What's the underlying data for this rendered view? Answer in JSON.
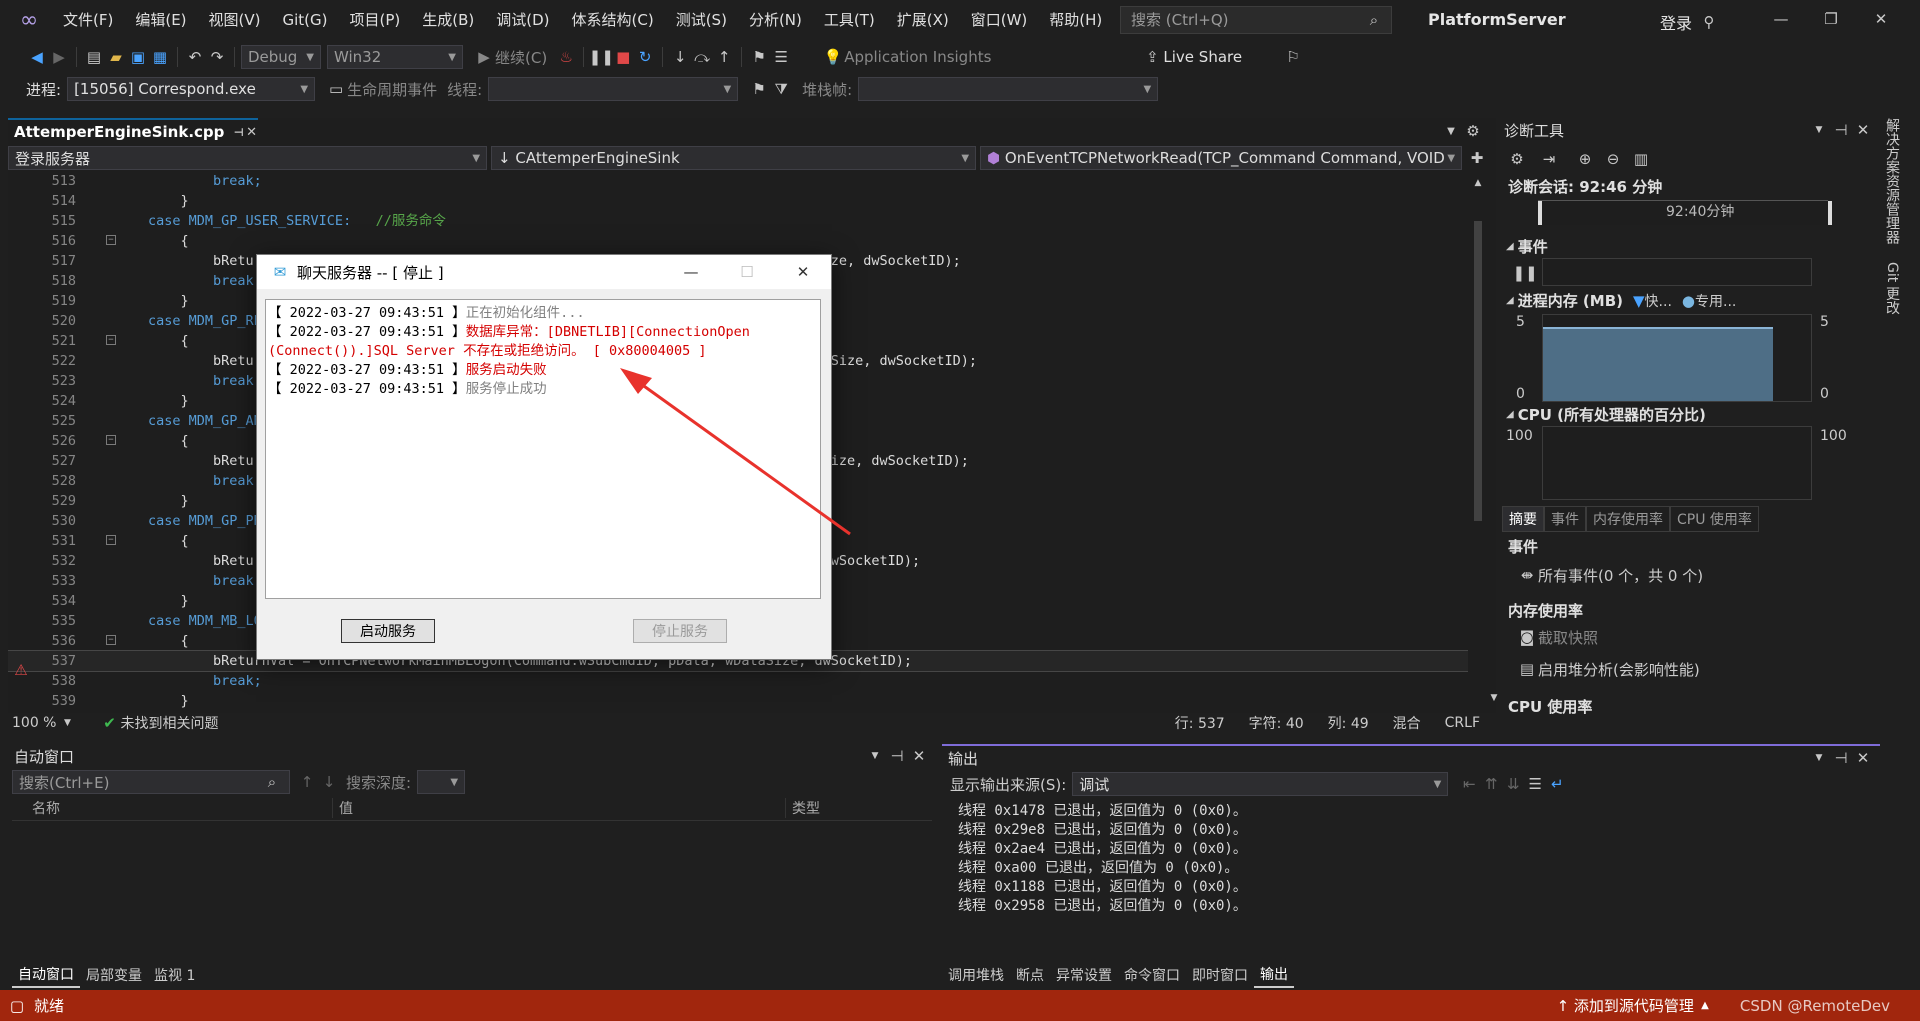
{
  "menu": {
    "items": [
      "文件(F)",
      "编辑(E)",
      "视图(V)",
      "Git(G)",
      "项目(P)",
      "生成(B)",
      "调试(D)",
      "体系结构(C)",
      "测试(S)",
      "分析(N)",
      "工具(T)",
      "扩展(X)",
      "窗口(W)",
      "帮助(H)"
    ],
    "search_placeholder": "搜索 (Ctrl+Q)",
    "app_title": "PlatformServer",
    "login": "登录"
  },
  "toolbar": {
    "config": "Debug",
    "platform": "Win32",
    "continue": "继续(C)",
    "insights": "Application Insights",
    "live_share": "Live Share",
    "process_label": "进程:",
    "process_value": "[15056] Correspond.exe",
    "lifecycle": "生命周期事件",
    "thread_label": "线程:",
    "stack_label": "堆栈帧:"
  },
  "editor": {
    "tab_name": "AttemperEngineSink.cpp",
    "nav_scope": "登录服务器",
    "nav_class": "CAttemperEngineSink",
    "nav_method": "OnEventTCPNetworkRead(TCP_Command Command, VOID *",
    "lines": [
      {
        "n": "513",
        "t": "        break;"
      },
      {
        "n": "514",
        "t": "    }"
      },
      {
        "n": "515",
        "t": "case MDM_GP_USER_SERVICE:   //服务命令"
      },
      {
        "n": "516",
        "t": "    {"
      },
      {
        "n": "517",
        "t": "        bReturnVal = OnTCPNetworkMainPCUserService(Command.wSubCmdID, pData, wDataSize, dwSocketID);"
      },
      {
        "n": "518",
        "t": "        break;"
      },
      {
        "n": "519",
        "t": "    }"
      },
      {
        "n": "520",
        "t": "case MDM_GP_REMOTE_SERVICE:"
      },
      {
        "n": "521",
        "t": "    {"
      },
      {
        "n": "522",
        "t": "        bReturnVal = OnTCPNetworkMainPCRemoteService(Command.wSubCmdID, pData, wDataSize, dwSocketID);"
      },
      {
        "n": "523",
        "t": "        break;"
      },
      {
        "n": "524",
        "t": "    }"
      },
      {
        "n": "525",
        "t": "case MDM_GP_ANDROID_SERVICE:"
      },
      {
        "n": "526",
        "t": "    {"
      },
      {
        "n": "527",
        "t": "        bReturnVal = OnTCPNetworkMainAndroidService(Command.wSubCmdID, pData, wDataSize, dwSocketID);"
      },
      {
        "n": "528",
        "t": "        break;"
      },
      {
        "n": "529",
        "t": "    }"
      },
      {
        "n": "530",
        "t": "case MDM_GP_PROPERTY:"
      },
      {
        "n": "531",
        "t": "    {"
      },
      {
        "n": "532",
        "t": "        bReturnVal = OnTCPNetworkMainProperty(Command.wSubCmdID, pData, wDataSize, dwSocketID);"
      },
      {
        "n": "533",
        "t": "        break;"
      },
      {
        "n": "534",
        "t": "    }"
      },
      {
        "n": "535",
        "t": "case MDM_MB_LOGON:"
      },
      {
        "n": "536",
        "t": "    {"
      },
      {
        "n": "537",
        "t": "        bReturnVal = OnTCPNetworkMainMBLogon(Command.wSubCmdID, pData, wDataSize, dwSocketID);"
      },
      {
        "n": "538",
        "t": "        break;"
      },
      {
        "n": "539",
        "t": "    }"
      }
    ],
    "zoom": "100 %",
    "issues": "未找到相关问题",
    "row": "行: 537",
    "char": "字符: 40",
    "col": "列: 49",
    "mixed": "混合",
    "crlf": "CRLF"
  },
  "dialog": {
    "title": "聊天服务器 -- [ 停止 ]",
    "logs": [
      {
        "ts": "【 2022-03-27 09:43:51 】",
        "msg": "正在初始化组件...",
        "kind": "grey"
      },
      {
        "ts": "【 2022-03-27 09:43:51 】",
        "msg": "数据库异常：[DBNETLIB][ConnectionOpen",
        "kind": "red"
      },
      {
        "ts": "",
        "msg": "(Connect()).]SQL Server 不存在或拒绝访问。 [ 0x80004005 ]",
        "kind": "red"
      },
      {
        "ts": "【 2022-03-27 09:43:51 】",
        "msg": "服务启动失败",
        "kind": "red"
      },
      {
        "ts": "【 2022-03-27 09:43:51 】",
        "msg": "服务停止成功",
        "kind": "grey"
      }
    ],
    "start_button": "启动服务",
    "stop_button": "停止服务"
  },
  "diagnostics": {
    "title": "诊断工具",
    "session": "诊断会话: 92:46 分钟",
    "timeline_label": "92:40分钟",
    "events_title": "事件",
    "memory_title": "进程内存 (MB)",
    "memory_legend_fast": "快...",
    "memory_legend_private": "专用...",
    "memory_max": "5",
    "memory_min": "0",
    "cpu_title": "CPU (所有处理器的百分比)",
    "cpu_max": "100",
    "subtabs": [
      "摘要",
      "事件",
      "内存使用率",
      "CPU 使用率"
    ],
    "summary_events": "事件",
    "all_events": "所有事件(0 个，共 0 个)",
    "mem_usage": "内存使用率",
    "snapshot": "截取快照",
    "heap": "启用堆分析(会影响性能)",
    "cpu_usage": "CPU 使用率"
  },
  "vstrip": [
    "解决方案资源管理器",
    "Git 更改"
  ],
  "autos": {
    "title": "自动窗口",
    "search": "搜索(Ctrl+E)",
    "depth": "搜索深度:",
    "col_name": "名称",
    "col_value": "值",
    "col_type": "类型",
    "tabs": [
      "自动窗口",
      "局部变量",
      "监视 1"
    ]
  },
  "output": {
    "title": "输出",
    "source_label": "显示输出来源(S):",
    "source_value": "调试",
    "lines": [
      "线程 0x1478 已退出，返回值为 0 (0x0)。",
      "线程 0x29e8 已退出，返回值为 0 (0x0)。",
      "线程 0x2ae4 已退出，返回值为 0 (0x0)。",
      "线程 0xa00 已退出，返回值为 0 (0x0)。",
      "线程 0x1188 已退出，返回值为 0 (0x0)。",
      "线程 0x2958 已退出，返回值为 0 (0x0)。"
    ],
    "tabs": [
      "调用堆栈",
      "断点",
      "异常设置",
      "命令窗口",
      "即时窗口",
      "输出"
    ]
  },
  "status": {
    "ready": "就绪",
    "source_control": "添加到源代码管理",
    "watermark": "CSDN @RemoteDev"
  },
  "colors": {
    "statusbar": "#a1260d",
    "accent": "#0e639c",
    "error_text": "#d40000"
  }
}
